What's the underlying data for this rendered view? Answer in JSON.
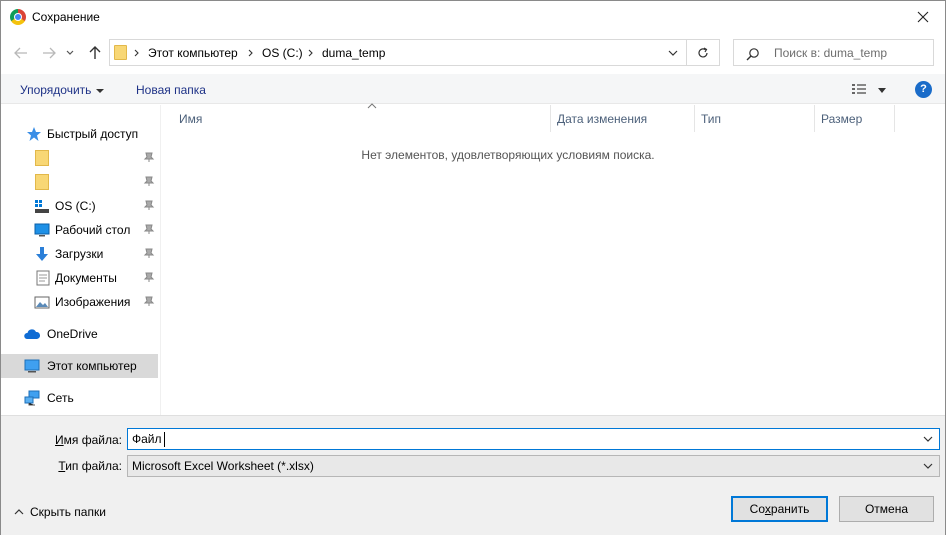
{
  "window": {
    "title": "Сохранение"
  },
  "address": {
    "crumbs": [
      "Этот компьютер",
      "OS (C:)",
      "duma_temp"
    ]
  },
  "search": {
    "placeholder": "Поиск в: duma_temp"
  },
  "toolbar": {
    "organize_label": "Упорядочить",
    "new_folder_label": "Новая папка",
    "help_label": "?"
  },
  "navpane": {
    "quick_access": "Быстрый доступ",
    "items": [
      {
        "label": "",
        "icon": "folder-icon",
        "pinned": true
      },
      {
        "label": "",
        "icon": "folder-icon",
        "pinned": true
      },
      {
        "label": "OS (C:)",
        "icon": "drive-icon",
        "pinned": true
      },
      {
        "label": "Рабочий стол",
        "icon": "desktop-icon",
        "pinned": true
      },
      {
        "label": "Загрузки",
        "icon": "downloads-icon",
        "pinned": true
      },
      {
        "label": "Документы",
        "icon": "documents-icon",
        "pinned": true
      },
      {
        "label": "Изображения",
        "icon": "pictures-icon",
        "pinned": true
      }
    ],
    "onedrive": "OneDrive",
    "this_pc": "Этот компьютер",
    "network": "Сеть"
  },
  "filelist": {
    "columns": [
      "Имя",
      "Дата изменения",
      "Тип",
      "Размер"
    ],
    "empty_message": "Нет элементов, удовлетворяющих условиям поиска."
  },
  "form": {
    "filename_label_accel": "И",
    "filename_label_rest": "мя файла:",
    "filename_value": "Файл",
    "filetype_label_accel": "Т",
    "filetype_label_rest": "ип файла:",
    "filetype_value": "Microsoft Excel Worksheet (*.xlsx)",
    "hide_folders_label": "Скрыть папки",
    "save_label_pre": "Со",
    "save_label_accel": "х",
    "save_label_post": "ранить",
    "cancel_label": "Отмена"
  },
  "colors": {
    "accent": "#0078d7",
    "link_text": "#1e3287",
    "selected_bg": "#d9d9d9",
    "folder": "#f8d775"
  }
}
